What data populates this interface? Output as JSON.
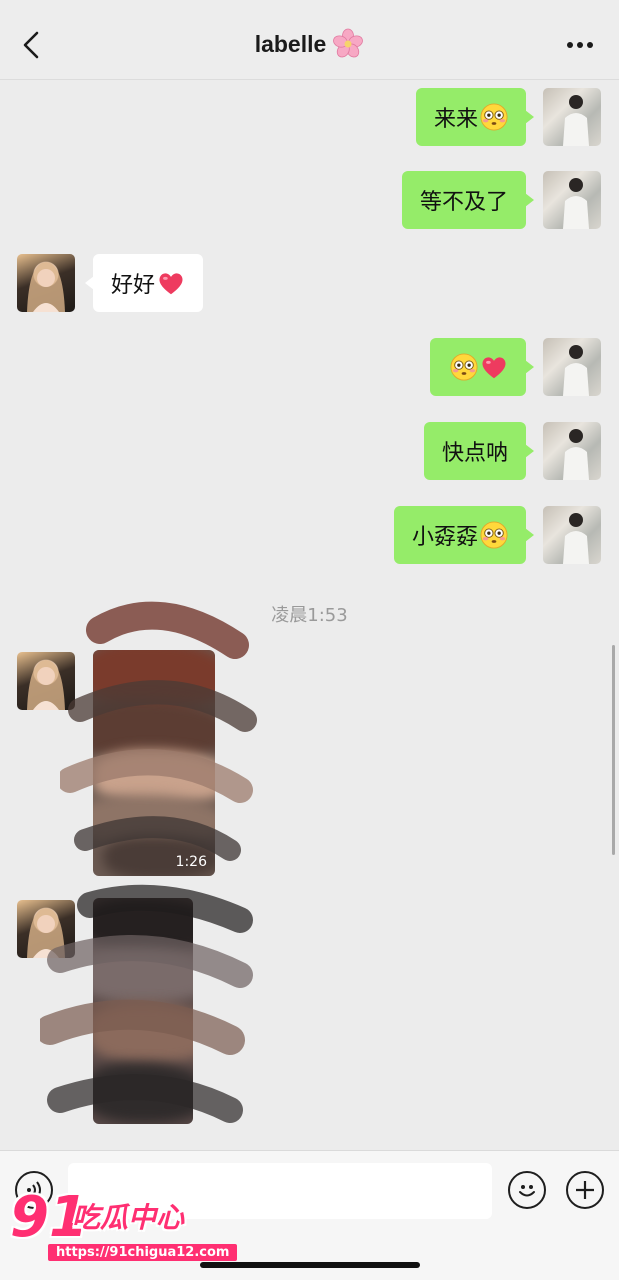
{
  "header": {
    "title": "labelle",
    "title_icon": "cherry-blossom-icon",
    "back_icon": "chevron-left-icon",
    "more_icon": "more-dots-icon"
  },
  "messages": [
    {
      "direction": "out",
      "text": "来来",
      "emoji": "flushed-face-icon"
    },
    {
      "direction": "out",
      "text": "等不及了"
    },
    {
      "direction": "in",
      "text": "好好",
      "emoji": "heart-icon"
    },
    {
      "direction": "out",
      "text": "",
      "emoji": "flushed-face-icon heart-icon"
    },
    {
      "direction": "out",
      "text": "快点呐"
    },
    {
      "direction": "out",
      "text": "小孬孬",
      "emoji": "flushed-face-icon"
    }
  ],
  "timestamp": "凌晨1:53",
  "videos": [
    {
      "direction": "in",
      "duration": "1:26"
    },
    {
      "direction": "in",
      "duration": ""
    }
  ],
  "input_bar": {
    "voice_icon": "voice-icon",
    "emoji_icon": "smiley-icon",
    "plus_icon": "plus-icon",
    "placeholder": ""
  },
  "watermark": {
    "logo": "91",
    "brand": "吃瓜中心",
    "url": "https://91chigua12.com"
  },
  "colors": {
    "outgoing_bubble": "#95ec69",
    "incoming_bubble": "#ffffff",
    "background": "#ececec",
    "watermark": "#ff2f72"
  }
}
